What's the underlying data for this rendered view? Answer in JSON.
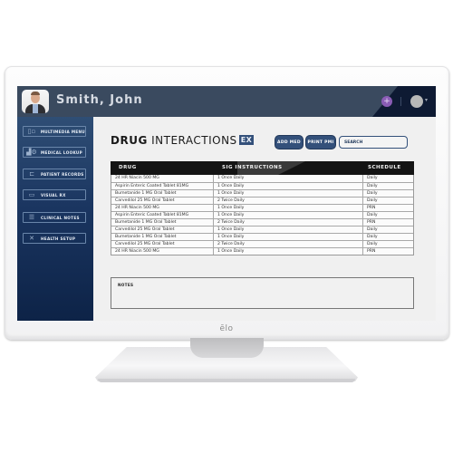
{
  "device": {
    "brand_logo": "ēlo"
  },
  "header": {
    "patient_name": "Smith, John",
    "add_icon": "plus-circle-icon",
    "profile_icon": "user-circle-icon",
    "profile_caret": "chevron-down-icon"
  },
  "sidebar": {
    "items": [
      {
        "label": "MULTIMEDIA MENU",
        "icon": "multimedia-icon",
        "glyph": "▯▫"
      },
      {
        "label": "MEDICAL LOOKUP",
        "icon": "medical-lookup-icon",
        "glyph": "▟⚙"
      },
      {
        "label": "PATIENT RECORDS",
        "icon": "patient-records-icon",
        "glyph": "⊏"
      },
      {
        "label": "VISUAL RX",
        "icon": "visual-rx-icon",
        "glyph": "▭"
      },
      {
        "label": "CLINICAL NOTES",
        "icon": "clinical-notes-icon",
        "glyph": "☰"
      },
      {
        "label": "HEALTH SETUP",
        "icon": "health-setup-icon",
        "glyph": "✕"
      }
    ]
  },
  "main": {
    "title_bold": "DRUG",
    "title_rest": " INTERACTIONS",
    "title_badge": "EX",
    "add_med_label": "ADD MED",
    "print_pmi_label": "PRINT PMI",
    "search_placeholder": "SEARCH",
    "table": {
      "columns": [
        "DRUG",
        "SIG INSTRUCTIONS",
        "SCHEDULE"
      ],
      "rows": [
        [
          "24 HR Niacin 500 MG",
          "1 Once Daily",
          "Daily"
        ],
        [
          "Aspirin Enteric Coated Tablet 81MG",
          "1 Once Daily",
          "Daily"
        ],
        [
          "Bumetanide 1 MG Oral Tablet",
          "1 Once Daily",
          "Daily"
        ],
        [
          "Carvedilol 25 MG Oral Tablet",
          "2 Twice Daily",
          "Daily"
        ],
        [
          "24 HR Niacin 500 MG",
          "1 Once Daily",
          "PRN"
        ],
        [
          "Aspirin Enteric Coated Tablet 81MG",
          "1 Once Daily",
          "Daily"
        ],
        [
          "Bumetanide 1 MG Oral Tablet",
          "2 Twice Daily",
          "PRN"
        ],
        [
          "Carvedilol 25 MG Oral Tablet",
          "1 Once Daily",
          "Daily"
        ],
        [
          "Bumetanide 1 MG Oral Tablet",
          "1 Once Daily",
          "Daily"
        ],
        [
          "Carvedilol 25 MG Oral Tablet",
          "2 Twice Daily",
          "Daily"
        ],
        [
          "24 HR Niacin 500 MG",
          "1 Once Daily",
          "PRN"
        ]
      ]
    },
    "notes_label": "NOTES"
  },
  "colors": {
    "header_bg": "#3a4a5f",
    "header_accent": "#0e1a33",
    "sidebar_top": "#2f4e75",
    "sidebar_bottom": "#0d2347",
    "button_bg": "#33507a",
    "add_button": "#8a5cb5",
    "table_header": "#141414"
  }
}
